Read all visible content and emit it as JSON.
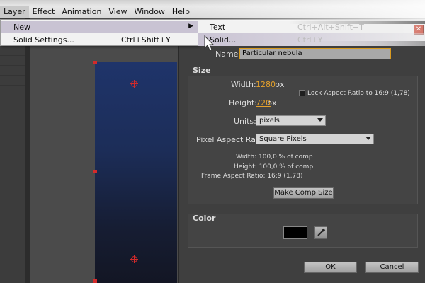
{
  "menubar": {
    "items": [
      "Layer",
      "Effect",
      "Animation",
      "View",
      "Window",
      "Help"
    ],
    "active": "Layer"
  },
  "layer_menu": {
    "items": [
      {
        "label": "New",
        "shortcut": "",
        "submenu": true
      },
      {
        "label": "Solid Settings...",
        "shortcut": "Ctrl+Shift+Y",
        "submenu": false
      }
    ]
  },
  "new_submenu": {
    "items": [
      {
        "label": "Text",
        "shortcut": "Ctrl+Alt+Shift+T"
      },
      {
        "label": "Solid...",
        "shortcut": "Ctrl+Y"
      }
    ]
  },
  "dialog": {
    "name_label": "Name:",
    "name_value": "Particular nebula",
    "size": {
      "title": "Size",
      "width_label": "Width:",
      "width_value": "1280",
      "width_unit": "px",
      "height_label": "Height:",
      "height_value": "720",
      "height_unit": "px",
      "lock_label": "Lock Aspect Ratio to 16:9 (1,78)",
      "units_label": "Units:",
      "units_value": "pixels",
      "par_label": "Pixel Aspect Ratio:",
      "par_value": "Square Pixels",
      "info_width": "Width: 100,0 % of comp",
      "info_height": "Height: 100,0 % of comp",
      "info_far": "Frame Aspect Ratio: 16:9 (1,78)",
      "make_comp_size": "Make Comp Size"
    },
    "color": {
      "title": "Color",
      "swatch": "#000000"
    },
    "ok_label": "OK",
    "cancel_label": "Cancel",
    "close_glyph": "✕"
  },
  "colors": {
    "accent_value": "#e5a12c",
    "name_border": "#d99a1f",
    "solid_top": "#1f346a",
    "handle": "#d42a2a"
  }
}
